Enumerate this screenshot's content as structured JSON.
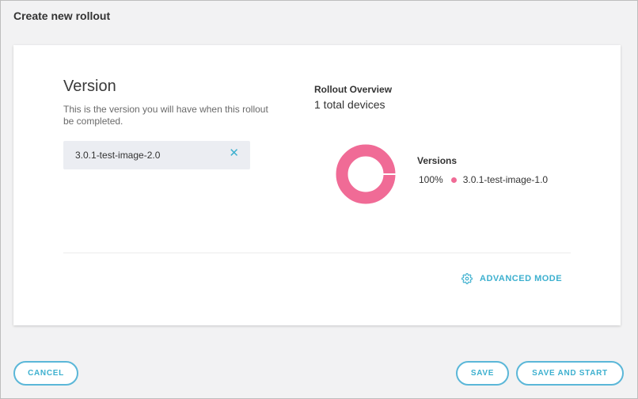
{
  "dialog": {
    "title": "Create new rollout"
  },
  "version_section": {
    "heading": "Version",
    "description": "This is the version you will have when this rollout be completed.",
    "selected_value": "3.0.1-test-image-2.0",
    "clear_icon": "close-icon",
    "clear_symbol": "✕"
  },
  "overview": {
    "title": "Rollout Overview",
    "total_devices": "1 total devices",
    "versions_label": "Versions",
    "chart_type": "donut",
    "slices": [
      {
        "label": "3.0.1-test-image-1.0",
        "percent_label": "100%",
        "percent": 100,
        "color": "#f06b96"
      }
    ]
  },
  "advanced": {
    "label": "ADVANCED MODE",
    "icon": "gear-icon"
  },
  "footer": {
    "cancel_label": "CANCEL",
    "save_label": "SAVE",
    "save_start_label": "SAVE AND START"
  },
  "colors": {
    "accent": "#3db0cf",
    "chart_slice": "#f06b96",
    "input_bg": "#ebedf2"
  }
}
